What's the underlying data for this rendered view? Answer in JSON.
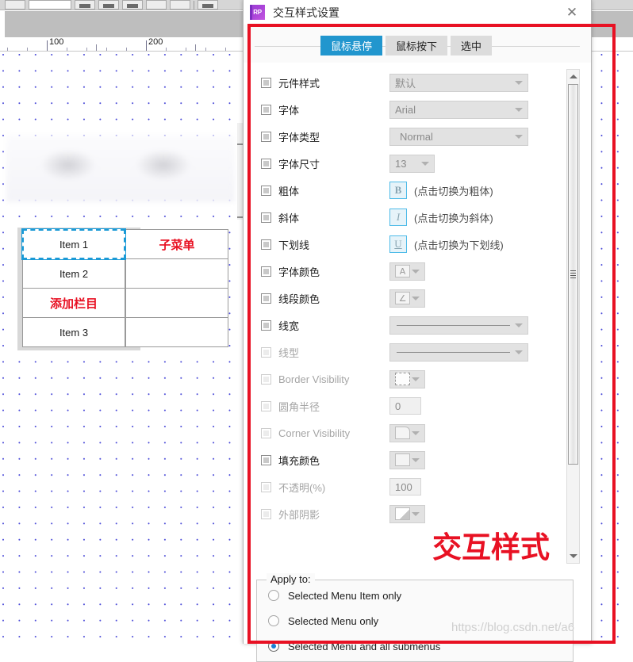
{
  "editor": {
    "ruler": {
      "labels": [
        "100",
        "200"
      ]
    },
    "menu": {
      "column_a": [
        "Item 1",
        "Item 2",
        "添加栏目",
        "Item 3"
      ],
      "column_b": [
        "子菜单",
        "",
        "",
        ""
      ],
      "selected_index": 0,
      "annotation_indices": [
        2
      ]
    }
  },
  "dialog": {
    "logo_text": "RP",
    "title": "交互样式设置",
    "close_label": "✕",
    "tabs": [
      {
        "label": "鼠标悬停",
        "active": true
      },
      {
        "label": "鼠标按下",
        "active": false
      },
      {
        "label": "选中",
        "active": false
      }
    ],
    "rows": [
      {
        "label": "元件样式",
        "kind": "select",
        "value": "默认",
        "width": "w175",
        "disabled": false
      },
      {
        "label": "字体",
        "kind": "select",
        "value": "Arial",
        "width": "w175",
        "disabled": false
      },
      {
        "label": "字体类型",
        "kind": "select",
        "value": "Normal",
        "width": "w175",
        "disabled": false,
        "indent": true
      },
      {
        "label": "字体尺寸",
        "kind": "select",
        "value": "13",
        "width": "w57",
        "disabled": false
      },
      {
        "label": "粗体",
        "kind": "toggle",
        "glyph": "B",
        "glyph_class": "b",
        "hint": "(点击切换为粗体)",
        "disabled": false
      },
      {
        "label": "斜体",
        "kind": "toggle",
        "glyph": "I",
        "glyph_class": "i",
        "hint": "(点击切换为斜体)",
        "disabled": false
      },
      {
        "label": "下划线",
        "kind": "toggle",
        "glyph": "U",
        "glyph_class": "u",
        "hint": "(点击切换为下划线)",
        "disabled": false
      },
      {
        "label": "字体颜色",
        "kind": "swatch",
        "glyph": "A",
        "swatch_class": "",
        "disabled": false
      },
      {
        "label": "线段颜色",
        "kind": "swatch",
        "glyph": "∠",
        "swatch_class": "",
        "disabled": false
      },
      {
        "label": "线宽",
        "kind": "lineselect",
        "value": "",
        "width": "w175",
        "disabled": false
      },
      {
        "label": "线型",
        "kind": "lineselect",
        "value": "",
        "width": "w175",
        "disabled": true
      },
      {
        "label": "Border Visibility",
        "kind": "swatch",
        "glyph": "",
        "swatch_class": "dashed",
        "disabled": true
      },
      {
        "label": "圆角半径",
        "kind": "number",
        "value": "0",
        "disabled": true
      },
      {
        "label": "Corner Visibility",
        "kind": "swatch",
        "glyph": "",
        "swatch_class": "rnd",
        "disabled": true
      },
      {
        "label": "填充颜色",
        "kind": "swatch",
        "glyph": "",
        "swatch_class": "",
        "disabled": false
      },
      {
        "label": "不透明(%)",
        "kind": "number",
        "value": "100",
        "disabled": true
      },
      {
        "label": "外部阴影",
        "kind": "swatch",
        "glyph": "",
        "swatch_class": "shadow",
        "disabled": true
      }
    ],
    "apply_to": {
      "legend": "Apply to:",
      "options": [
        {
          "label": "Selected Menu Item only",
          "checked": false
        },
        {
          "label": "Selected Menu only",
          "checked": false
        },
        {
          "label": "Selected Menu and all submenus",
          "checked": true
        }
      ]
    }
  },
  "annotations": {
    "main": "交互样式",
    "watermark": "https://blog.csdn.net/a6"
  },
  "colors": {
    "accent_blue": "#2196ce",
    "annotation_red": "#e81123",
    "logo_purple": "#a843d8",
    "selection_blue": "#1b9ad6"
  }
}
